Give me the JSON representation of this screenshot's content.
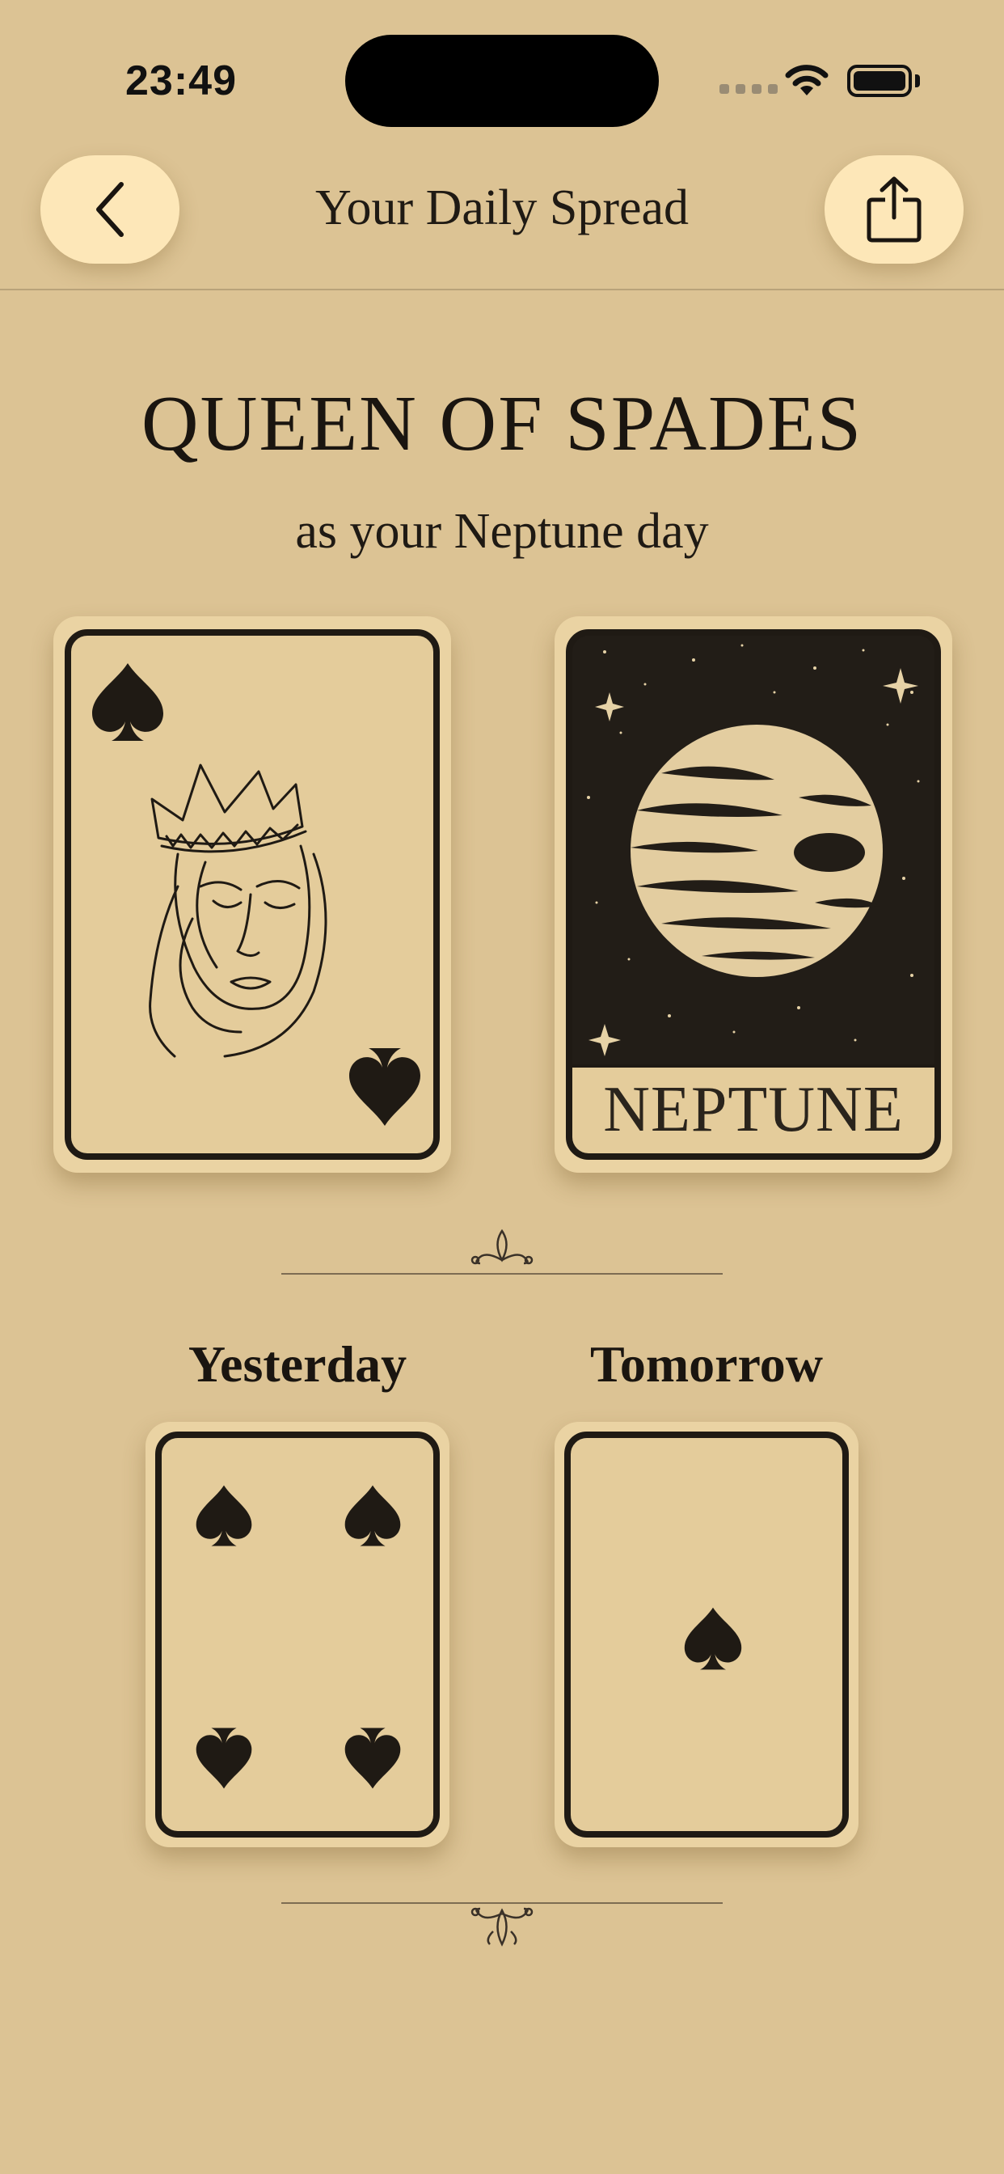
{
  "status_bar": {
    "time": "23:49"
  },
  "header": {
    "title": "Your Daily Spread",
    "back_icon": "chevron-left-icon",
    "share_icon": "share-icon"
  },
  "main": {
    "title": "QUEEN OF SPADES",
    "subtitle": "as your Neptune day",
    "cards": [
      {
        "name": "queen-of-spades-card",
        "suit": "spades",
        "rank": "Queen"
      },
      {
        "name": "neptune-card",
        "label": "NEPTUNE"
      }
    ]
  },
  "days": {
    "yesterday": {
      "label": "Yesterday",
      "card_rank": "4",
      "card_suit": "spades"
    },
    "tomorrow": {
      "label": "Tomorrow",
      "card_rank": "Ace",
      "card_suit": "spades"
    }
  },
  "colors": {
    "background": "#dcc394",
    "button": "#fde7b8",
    "ink": "#1f1a14",
    "card": "#e4cc9b"
  }
}
